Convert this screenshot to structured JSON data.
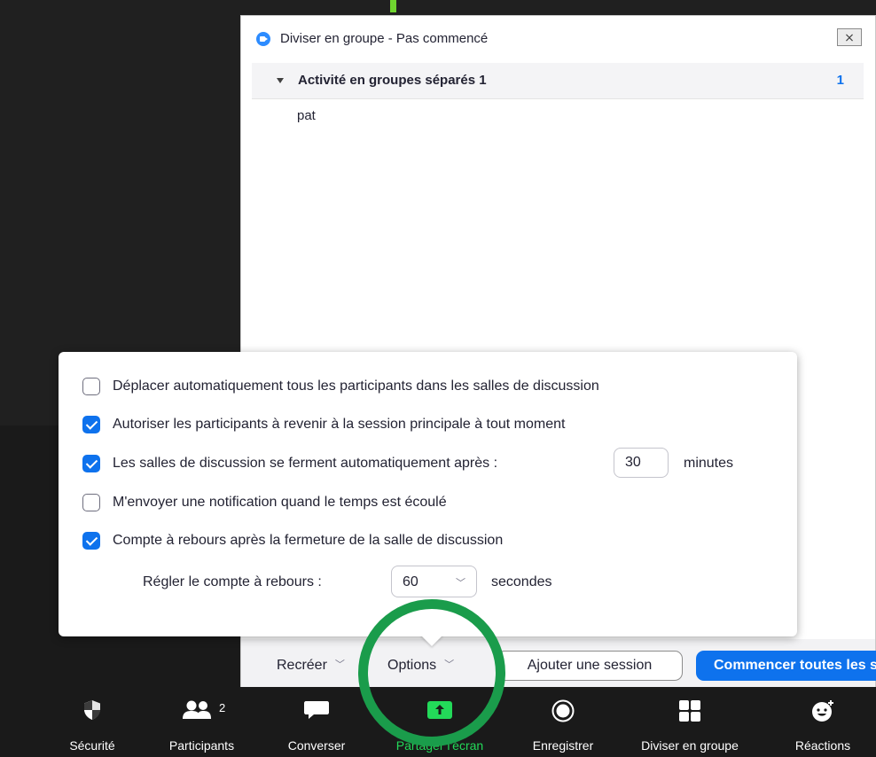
{
  "window": {
    "title": "Diviser en groupe - Pas commencé",
    "close_label": "⨯"
  },
  "rooms": [
    {
      "name": "Activité en groupes séparés 1",
      "count": "1",
      "participants": [
        "pat"
      ]
    }
  ],
  "options": {
    "items": [
      {
        "label": "Déplacer automatiquement tous les participants dans les salles de discussion",
        "checked": false
      },
      {
        "label": "Autoriser les participants à revenir à la session principale à tout moment",
        "checked": true
      },
      {
        "label": "Les salles de discussion se ferment automatiquement après :",
        "checked": true
      },
      {
        "label": "M'envoyer une notification quand le temps est écoulé",
        "checked": false
      },
      {
        "label": "Compte à rebours après la fermeture de la salle de discussion",
        "checked": true
      }
    ],
    "close_minutes_value": "30",
    "minutes_label": "minutes",
    "countdown_label": "Régler le compte à rebours :",
    "countdown_value": "60",
    "seconds_label": "secondes"
  },
  "footer": {
    "recreate_label": "Recréer",
    "options_label": "Options",
    "add_session_label": "Ajouter une session",
    "start_all_label": "Commencer toutes les sessions"
  },
  "toolbar": {
    "items": [
      {
        "label": "Sécurité",
        "icon": "shield-icon"
      },
      {
        "label": "Participants",
        "icon": "participants-icon",
        "badge": "2"
      },
      {
        "label": "Converser",
        "icon": "chat-icon"
      },
      {
        "label": "Partager l'écran",
        "icon": "share-screen-icon"
      },
      {
        "label": "Enregistrer",
        "icon": "record-icon"
      },
      {
        "label": "Diviser en groupe",
        "icon": "breakout-rooms-icon"
      },
      {
        "label": "Réactions",
        "icon": "reactions-icon"
      }
    ]
  },
  "colors": {
    "accent": "#0e72ed",
    "share_green": "#23d959",
    "highlight_circle": "#1a9c4b"
  }
}
